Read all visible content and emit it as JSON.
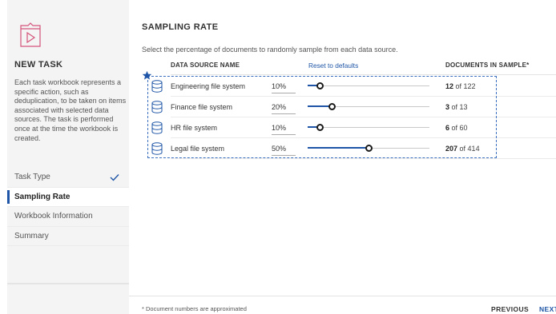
{
  "sidebar": {
    "heading": "NEW TASK",
    "description": "Each task workbook represents a specific action, such as deduplication, to be taken on items associated with selected data sources. The task is performed once at the time the workbook is created.",
    "steps": [
      {
        "label": "Task Type",
        "completed": true
      },
      {
        "label": "Sampling Rate",
        "active": true
      },
      {
        "label": "Workbook Information"
      },
      {
        "label": "Summary"
      }
    ]
  },
  "main": {
    "title": "SAMPLING RATE",
    "instruction": "Select the percentage of documents to randomly sample from each data source.",
    "columns": {
      "name": "DATA SOURCE NAME",
      "reset": "Reset to defaults",
      "documents": "DOCUMENTS IN SAMPLE*"
    },
    "rows": [
      {
        "name": "Engineering file system",
        "percent": "10%",
        "slider_value": 10,
        "sampled": "12",
        "of_label": "of 122"
      },
      {
        "name": "Finance file system",
        "percent": "20%",
        "slider_value": 20,
        "sampled": "3",
        "of_label": "of 13"
      },
      {
        "name": "HR file system",
        "percent": "10%",
        "slider_value": 10,
        "sampled": "6",
        "of_label": "of 60"
      },
      {
        "name": "Legal file system",
        "percent": "50%",
        "slider_value": 50,
        "sampled": "207",
        "of_label": "of 414"
      }
    ]
  },
  "footer": {
    "note": "* Document numbers are approximated",
    "previous_label": "PREVIOUS",
    "next_label": "NEXT"
  },
  "colors": {
    "accent": "#1e55a6",
    "sidebar_bg": "#f4f4f4"
  },
  "icons": {
    "task": "workbook-play-icon",
    "completed": "checkmark-icon",
    "data_source": "database-icon",
    "selection": "star-icon"
  }
}
